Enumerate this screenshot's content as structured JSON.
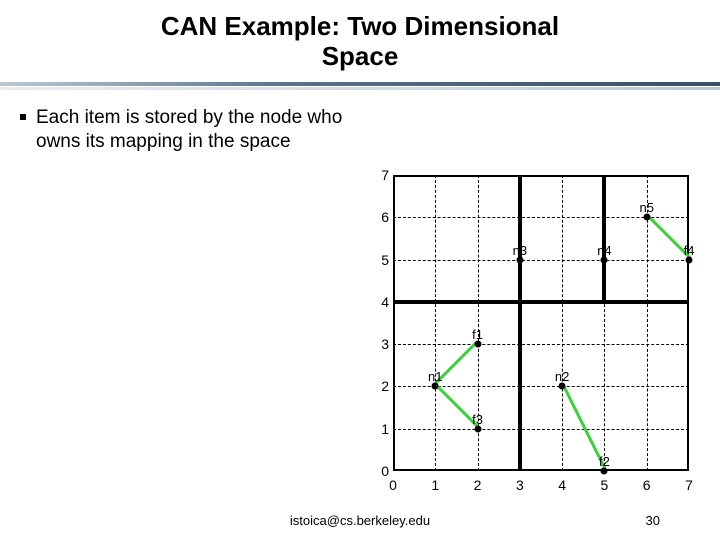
{
  "title_line1": "CAN Example: Two Dimensional",
  "title_line2": "Space",
  "bullet": "Each item is stored by the node who owns its mapping in the space",
  "footer_email": "istoica@cs.berkeley.edu",
  "page_number": "30",
  "chart_data": {
    "type": "scatter",
    "xlim": [
      0,
      7
    ],
    "ylim": [
      0,
      7
    ],
    "x_ticks": [
      0,
      1,
      2,
      3,
      4,
      5,
      6,
      7
    ],
    "y_ticks": [
      0,
      1,
      2,
      3,
      4,
      5,
      6,
      7
    ],
    "zone_borders": [
      {
        "x0": 0,
        "y0": 0,
        "x1": 7,
        "y1": 7
      },
      {
        "x0": 0,
        "y0": 0,
        "x1": 3,
        "y1": 4
      },
      {
        "x0": 3,
        "y0": 0,
        "x1": 7,
        "y1": 4
      },
      {
        "x0": 0,
        "y0": 4,
        "x1": 3,
        "y1": 7
      },
      {
        "x0": 3,
        "y0": 4,
        "x1": 5,
        "y1": 7
      },
      {
        "x0": 5,
        "y0": 4,
        "x1": 7,
        "y1": 7
      }
    ],
    "nodes": [
      {
        "name": "n1",
        "x": 1,
        "y": 2
      },
      {
        "name": "n2",
        "x": 4,
        "y": 2
      },
      {
        "name": "n3",
        "x": 3,
        "y": 5
      },
      {
        "name": "n4",
        "x": 5,
        "y": 5
      },
      {
        "name": "n5",
        "x": 6,
        "y": 6
      }
    ],
    "items": [
      {
        "name": "f1",
        "x": 2,
        "y": 3,
        "owner": "n1"
      },
      {
        "name": "f2",
        "x": 5,
        "y": 0,
        "owner": "n2"
      },
      {
        "name": "f3",
        "x": 2,
        "y": 1,
        "owner": "n1"
      },
      {
        "name": "f4",
        "x": 7,
        "y": 5,
        "owner": "n5"
      }
    ]
  }
}
